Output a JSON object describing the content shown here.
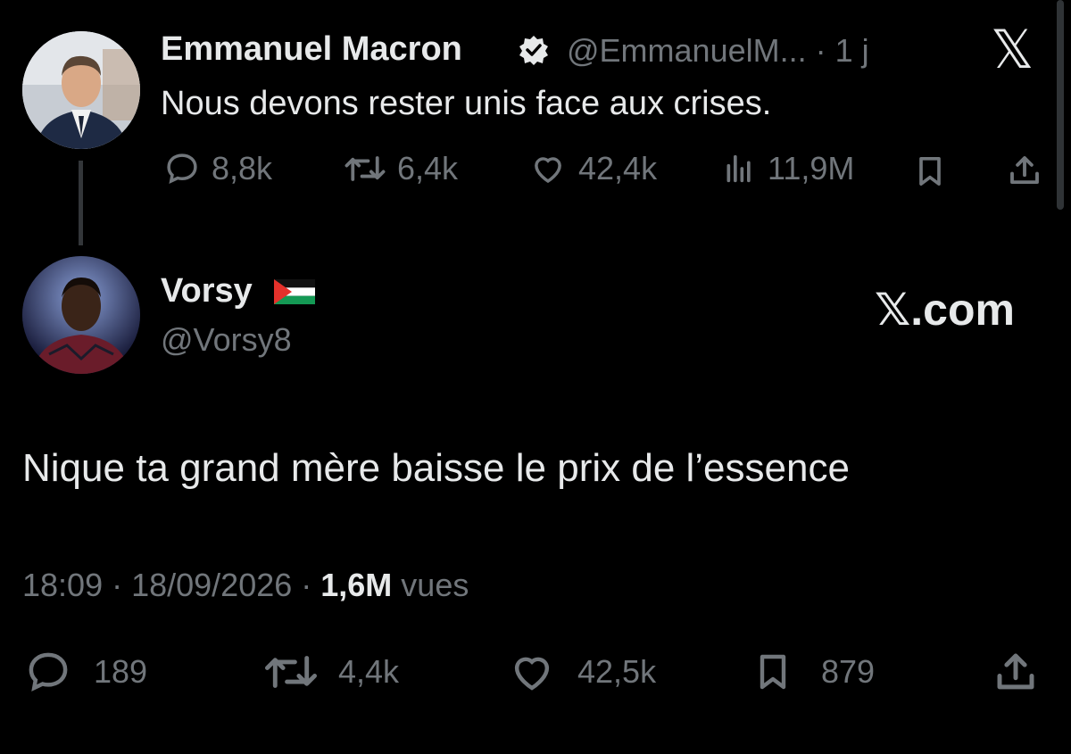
{
  "original_tweet": {
    "author_name": "Emmanuel Macron",
    "handle_time": "@EmmanuelM... · 1 j",
    "text": "Nous devons rester unis face aux crises.",
    "stats": {
      "replies": "8,8k",
      "retweets": "6,4k",
      "likes": "42,4k",
      "views": "11,9M"
    }
  },
  "reply_tweet": {
    "author_name": "Vorsy",
    "handle": "@Vorsy8",
    "text": "Nique ta grand mère baisse le prix de l’essence",
    "meta_time": "18:09 · 18/09/2026 · ",
    "views_count": "1,6M",
    "views_label": " vues",
    "stats": {
      "replies": "189",
      "retweets": "4,4k",
      "likes": "42,5k",
      "bookmarks": "879"
    }
  },
  "branding": {
    "xcom_label": "𝕏.com",
    "x_logo_glyph": "𝕏"
  },
  "colors": {
    "background": "#000000",
    "primary_text": "#e7e9ea",
    "secondary_text": "#71767b",
    "verified_badge": "#e7e9ea"
  },
  "icons": [
    "verified-badge-icon",
    "x-logo-icon",
    "reply-icon",
    "retweet-icon",
    "like-icon",
    "views-icon",
    "bookmark-icon",
    "share-icon",
    "palestine-flag-icon"
  ]
}
